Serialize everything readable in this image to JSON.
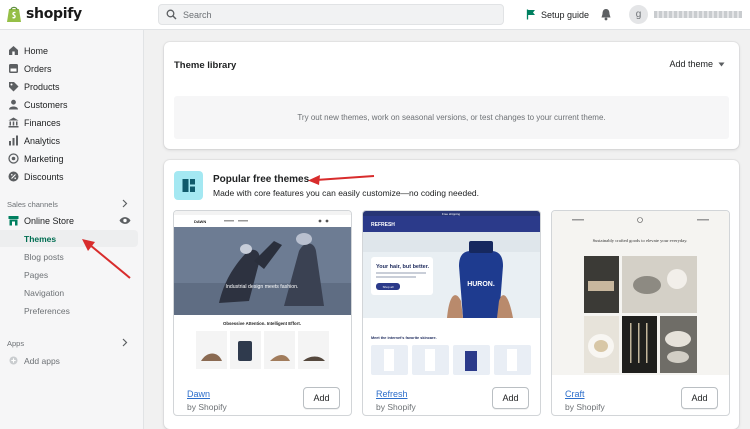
{
  "topbar": {
    "logo_text": "shopify",
    "search_placeholder": "Search",
    "setup_guide": "Setup guide",
    "avatar_initial": "g"
  },
  "sidebar": {
    "items": [
      {
        "label": "Home",
        "icon": "home-icon"
      },
      {
        "label": "Orders",
        "icon": "orders-icon"
      },
      {
        "label": "Products",
        "icon": "tag-icon"
      },
      {
        "label": "Customers",
        "icon": "person-icon"
      },
      {
        "label": "Finances",
        "icon": "bank-icon"
      },
      {
        "label": "Analytics",
        "icon": "bar-chart-icon"
      },
      {
        "label": "Marketing",
        "icon": "target-icon"
      },
      {
        "label": "Discounts",
        "icon": "discount-icon"
      }
    ],
    "sales_channels_label": "Sales channels",
    "online_store": "Online Store",
    "sub_items": [
      "Themes",
      "Blog posts",
      "Pages",
      "Navigation",
      "Preferences"
    ],
    "apps_label": "Apps",
    "add_apps": "Add apps"
  },
  "theme_library": {
    "title": "Theme library",
    "add_theme": "Add theme",
    "empty_text": "Try out new themes, work on seasonal versions, or test changes to your current theme."
  },
  "popular": {
    "title": "Popular free themes",
    "subtitle": "Made with core features you can easily customize—no coding needed.",
    "themes": [
      {
        "name": "Dawn",
        "by": "by Shopify",
        "add": "Add",
        "brand": "DAWN",
        "hero_text": "Industrial design meets fashion.",
        "section_text": "Obsessive Attention. Intelligent Effort."
      },
      {
        "name": "Refresh",
        "by": "by Shopify",
        "add": "Add",
        "announce": "Free shipping",
        "brand": "REFRESH",
        "hero_text": "Your hair, but better.",
        "cta": "Shop all",
        "product": "HURON.",
        "section_text": "Meet the internet's favorite skincare."
      },
      {
        "name": "Craft",
        "by": "by Shopify",
        "add": "Add",
        "hero_text": "Sustainably crafted goods to elevate your everyday."
      }
    ]
  },
  "colors": {
    "accent_green": "#008060",
    "link_blue": "#2c6ecb",
    "annotation_red": "#d82c2c"
  }
}
